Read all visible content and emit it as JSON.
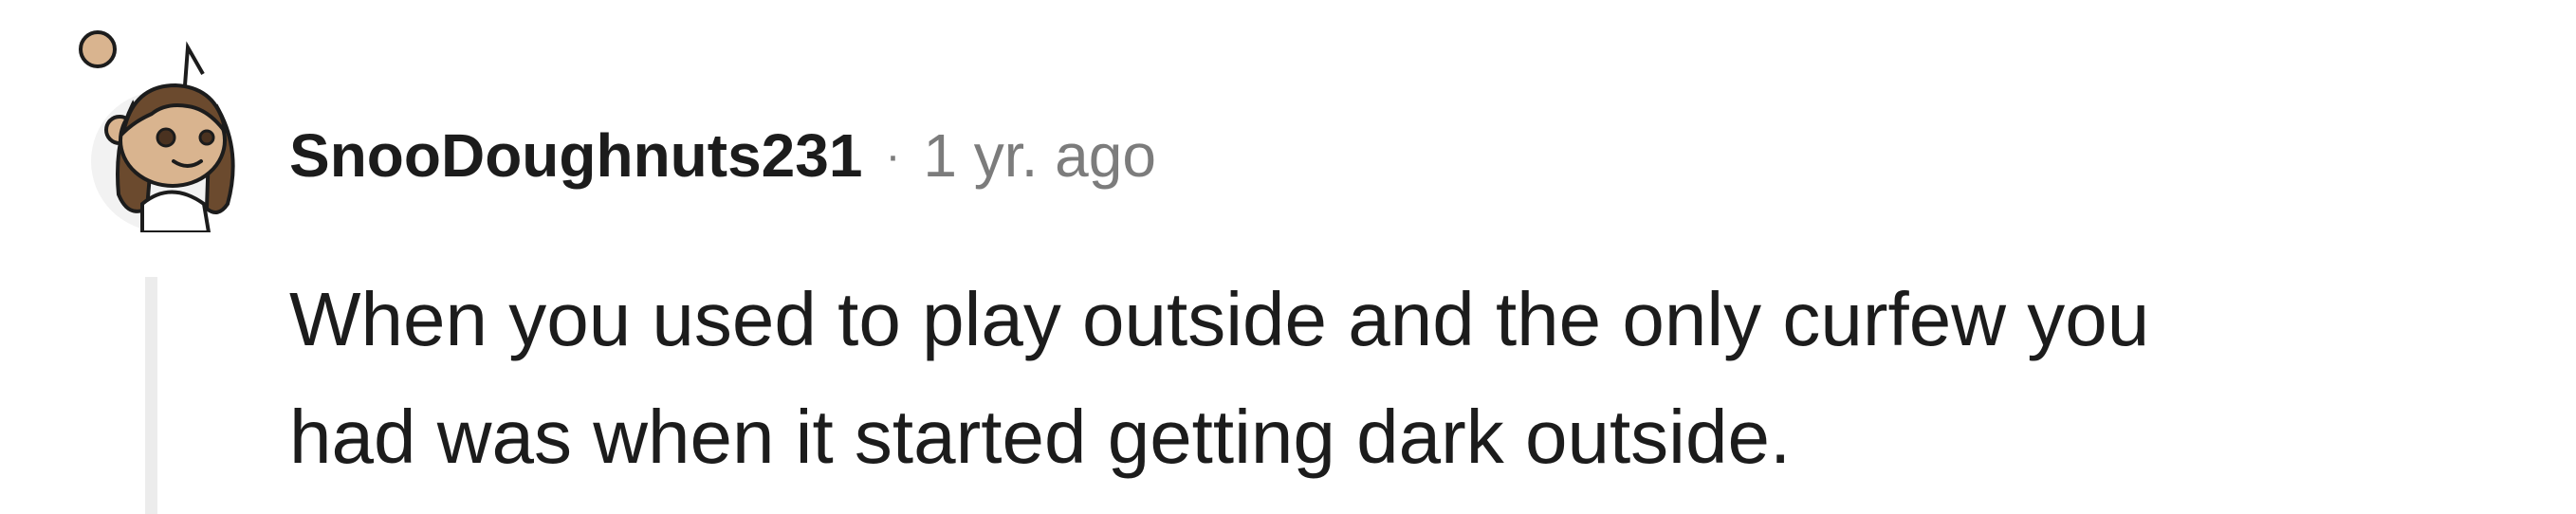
{
  "comment": {
    "username": "SnooDoughnuts231",
    "separator": "·",
    "timestamp": "1 yr. ago",
    "body_lines": [
      "When you used to play outside and the only curfew you",
      "had was when it started getting dark outside."
    ],
    "avatar_icon": "snoo-avatar-icon"
  },
  "colors": {
    "text": "#1c1c1c",
    "meta": "#7c7c7c",
    "thread_line": "#ececec",
    "skin": "#d9b48f",
    "hair": "#6b4a2e"
  }
}
